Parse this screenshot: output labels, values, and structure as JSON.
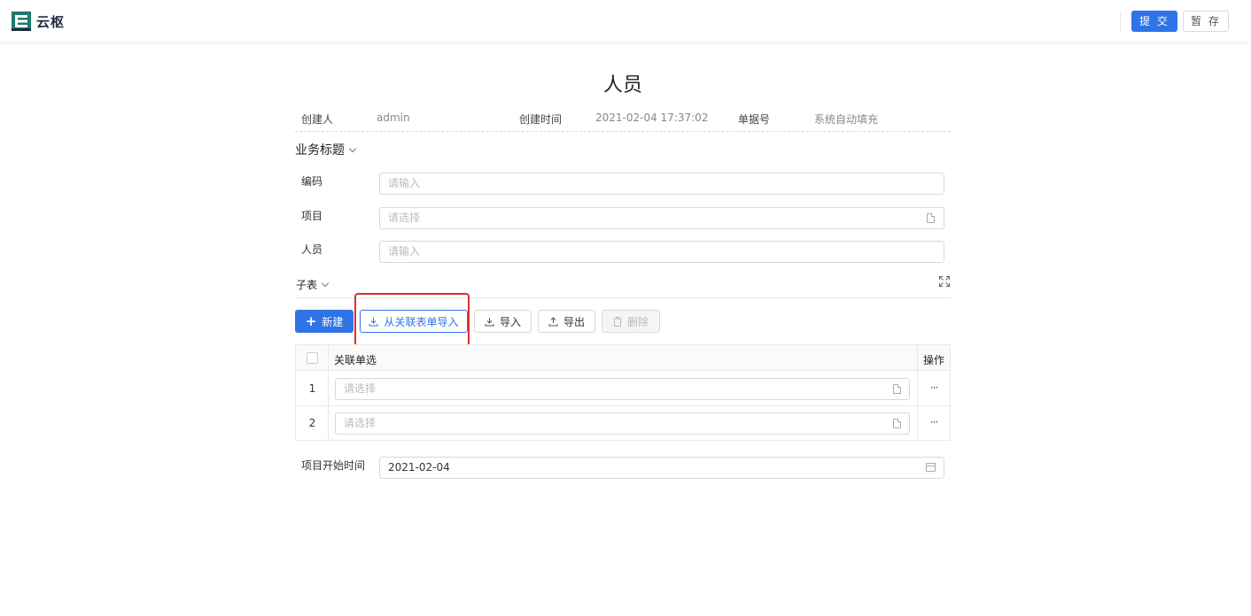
{
  "header": {
    "logo_text": "云枢",
    "submit_label": "提 交",
    "save_label": "暂 存"
  },
  "page": {
    "title": "人员"
  },
  "meta": {
    "creator_label": "创建人",
    "creator_value": "admin",
    "created_time_label": "创建时间",
    "created_time_value": "2021-02-04 17:37:02",
    "doc_no_label": "单据号",
    "doc_no_value": "系统自动填充"
  },
  "section": {
    "title": "业务标题"
  },
  "fields": {
    "code_label": "编码",
    "code_placeholder": "请输入",
    "project_label": "项目",
    "project_placeholder": "请选择",
    "person_label": "人员",
    "person_placeholder": "请输入",
    "start_time_label": "项目开始时间",
    "start_time_value": "2021-02-04"
  },
  "subtable": {
    "title": "子表",
    "toolbar": {
      "new_label": "新建",
      "import_related_label": "从关联表单导入",
      "import_label": "导入",
      "export_label": "导出",
      "delete_label": "删除"
    },
    "columns": {
      "related_single": "关联单选",
      "actions": "操作"
    },
    "rows": [
      {
        "index": "1",
        "placeholder": "请选择",
        "more": "···"
      },
      {
        "index": "2",
        "placeholder": "请选择",
        "more": "···"
      }
    ]
  },
  "colors": {
    "primary": "#2f74e6",
    "highlight": "#d9302c"
  }
}
